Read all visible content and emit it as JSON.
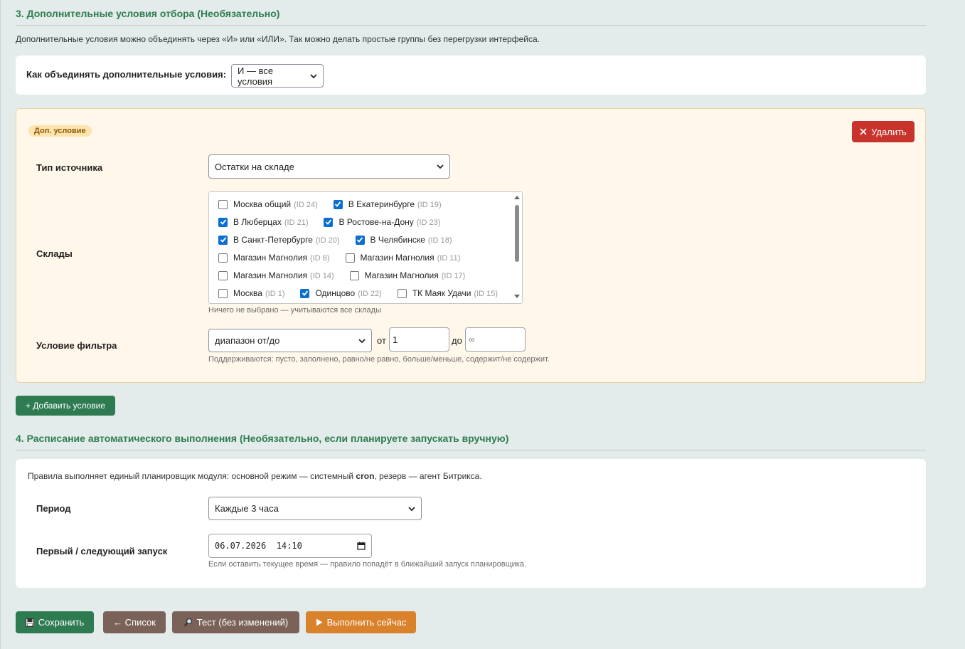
{
  "section3": {
    "title": "3. Дополнительные условия отбора (Необязательно)",
    "description": "Дополнительные условия можно объединять через «И» или «ИЛИ». Так можно делать простые группы без перегрузки интерфейса.",
    "combine_label": "Как объединять дополнительные условия:",
    "combine_value": "И — все условия"
  },
  "condition": {
    "badge": "Доп. условие",
    "delete_label": "Удалить",
    "source_type_label": "Тип источника",
    "source_type_value": "Остатки на складе",
    "warehouses_label": "Склады",
    "warehouses_hint": "Ничего не выбрано — учитываются все склады",
    "warehouses": [
      {
        "name": "Москва общий",
        "id": "(ID 24)",
        "checked": false
      },
      {
        "name": "В Екатеринбурге",
        "id": "(ID 19)",
        "checked": true
      },
      {
        "name": "В Люберцах",
        "id": "(ID 21)",
        "checked": true
      },
      {
        "name": "В Ростове-на-Дону",
        "id": "(ID 23)",
        "checked": true
      },
      {
        "name": "В Санкт-Петербурге",
        "id": "(ID 20)",
        "checked": true
      },
      {
        "name": "В Челябинске",
        "id": "(ID 18)",
        "checked": true
      },
      {
        "name": "Магазин Магнолия",
        "id": "(ID 8)",
        "checked": false
      },
      {
        "name": "Магазин Магнолия",
        "id": "(ID 11)",
        "checked": false
      },
      {
        "name": "Магазин Магнолия",
        "id": "(ID 14)",
        "checked": false
      },
      {
        "name": "Магазин Магнолия",
        "id": "(ID 17)",
        "checked": false
      },
      {
        "name": "Москва",
        "id": "(ID 1)",
        "checked": false
      },
      {
        "name": "Одинцово",
        "id": "(ID 22)",
        "checked": true
      },
      {
        "name": "ТК Маяк Удачи",
        "id": "(ID 15)",
        "checked": false
      }
    ],
    "filter_label": "Условие фильтра",
    "filter_value": "диапазон от/до",
    "from_label": "от",
    "from_value": "1",
    "to_label": "до",
    "to_placeholder": "∞",
    "filter_hint": "Поддерживаются: пусто, заполнено, равно/не равно, больше/меньше, содержит/не содержит."
  },
  "add_condition_label": "+ Добавить условие",
  "section4": {
    "title": "4. Расписание автоматического выполнения (Необязательно, если планируете запускать вручную)",
    "note_prefix": "Правила выполняет единый планировщик модуля: основной режим — системный ",
    "note_bold": "cron",
    "note_suffix": ", резерв — агент Битрикса.",
    "period_label": "Период",
    "period_value": "Каждые 3 часа",
    "next_run_label": "Первый / следующий запуск",
    "next_run_value": "06.07.2026  14:10",
    "next_run_hint": "Если оставить текущее время — правило попадёт в ближайший запуск планировщика."
  },
  "actions": {
    "save": "Сохранить",
    "list": "← Список",
    "test": "Тест (без изменений)",
    "run": "Выполнить сейчас"
  },
  "colors": {
    "green": "#2e7b52",
    "brown": "#7a6258",
    "orange": "#d9822b",
    "red": "#c8332b",
    "title_green": "#2e7d4f"
  }
}
